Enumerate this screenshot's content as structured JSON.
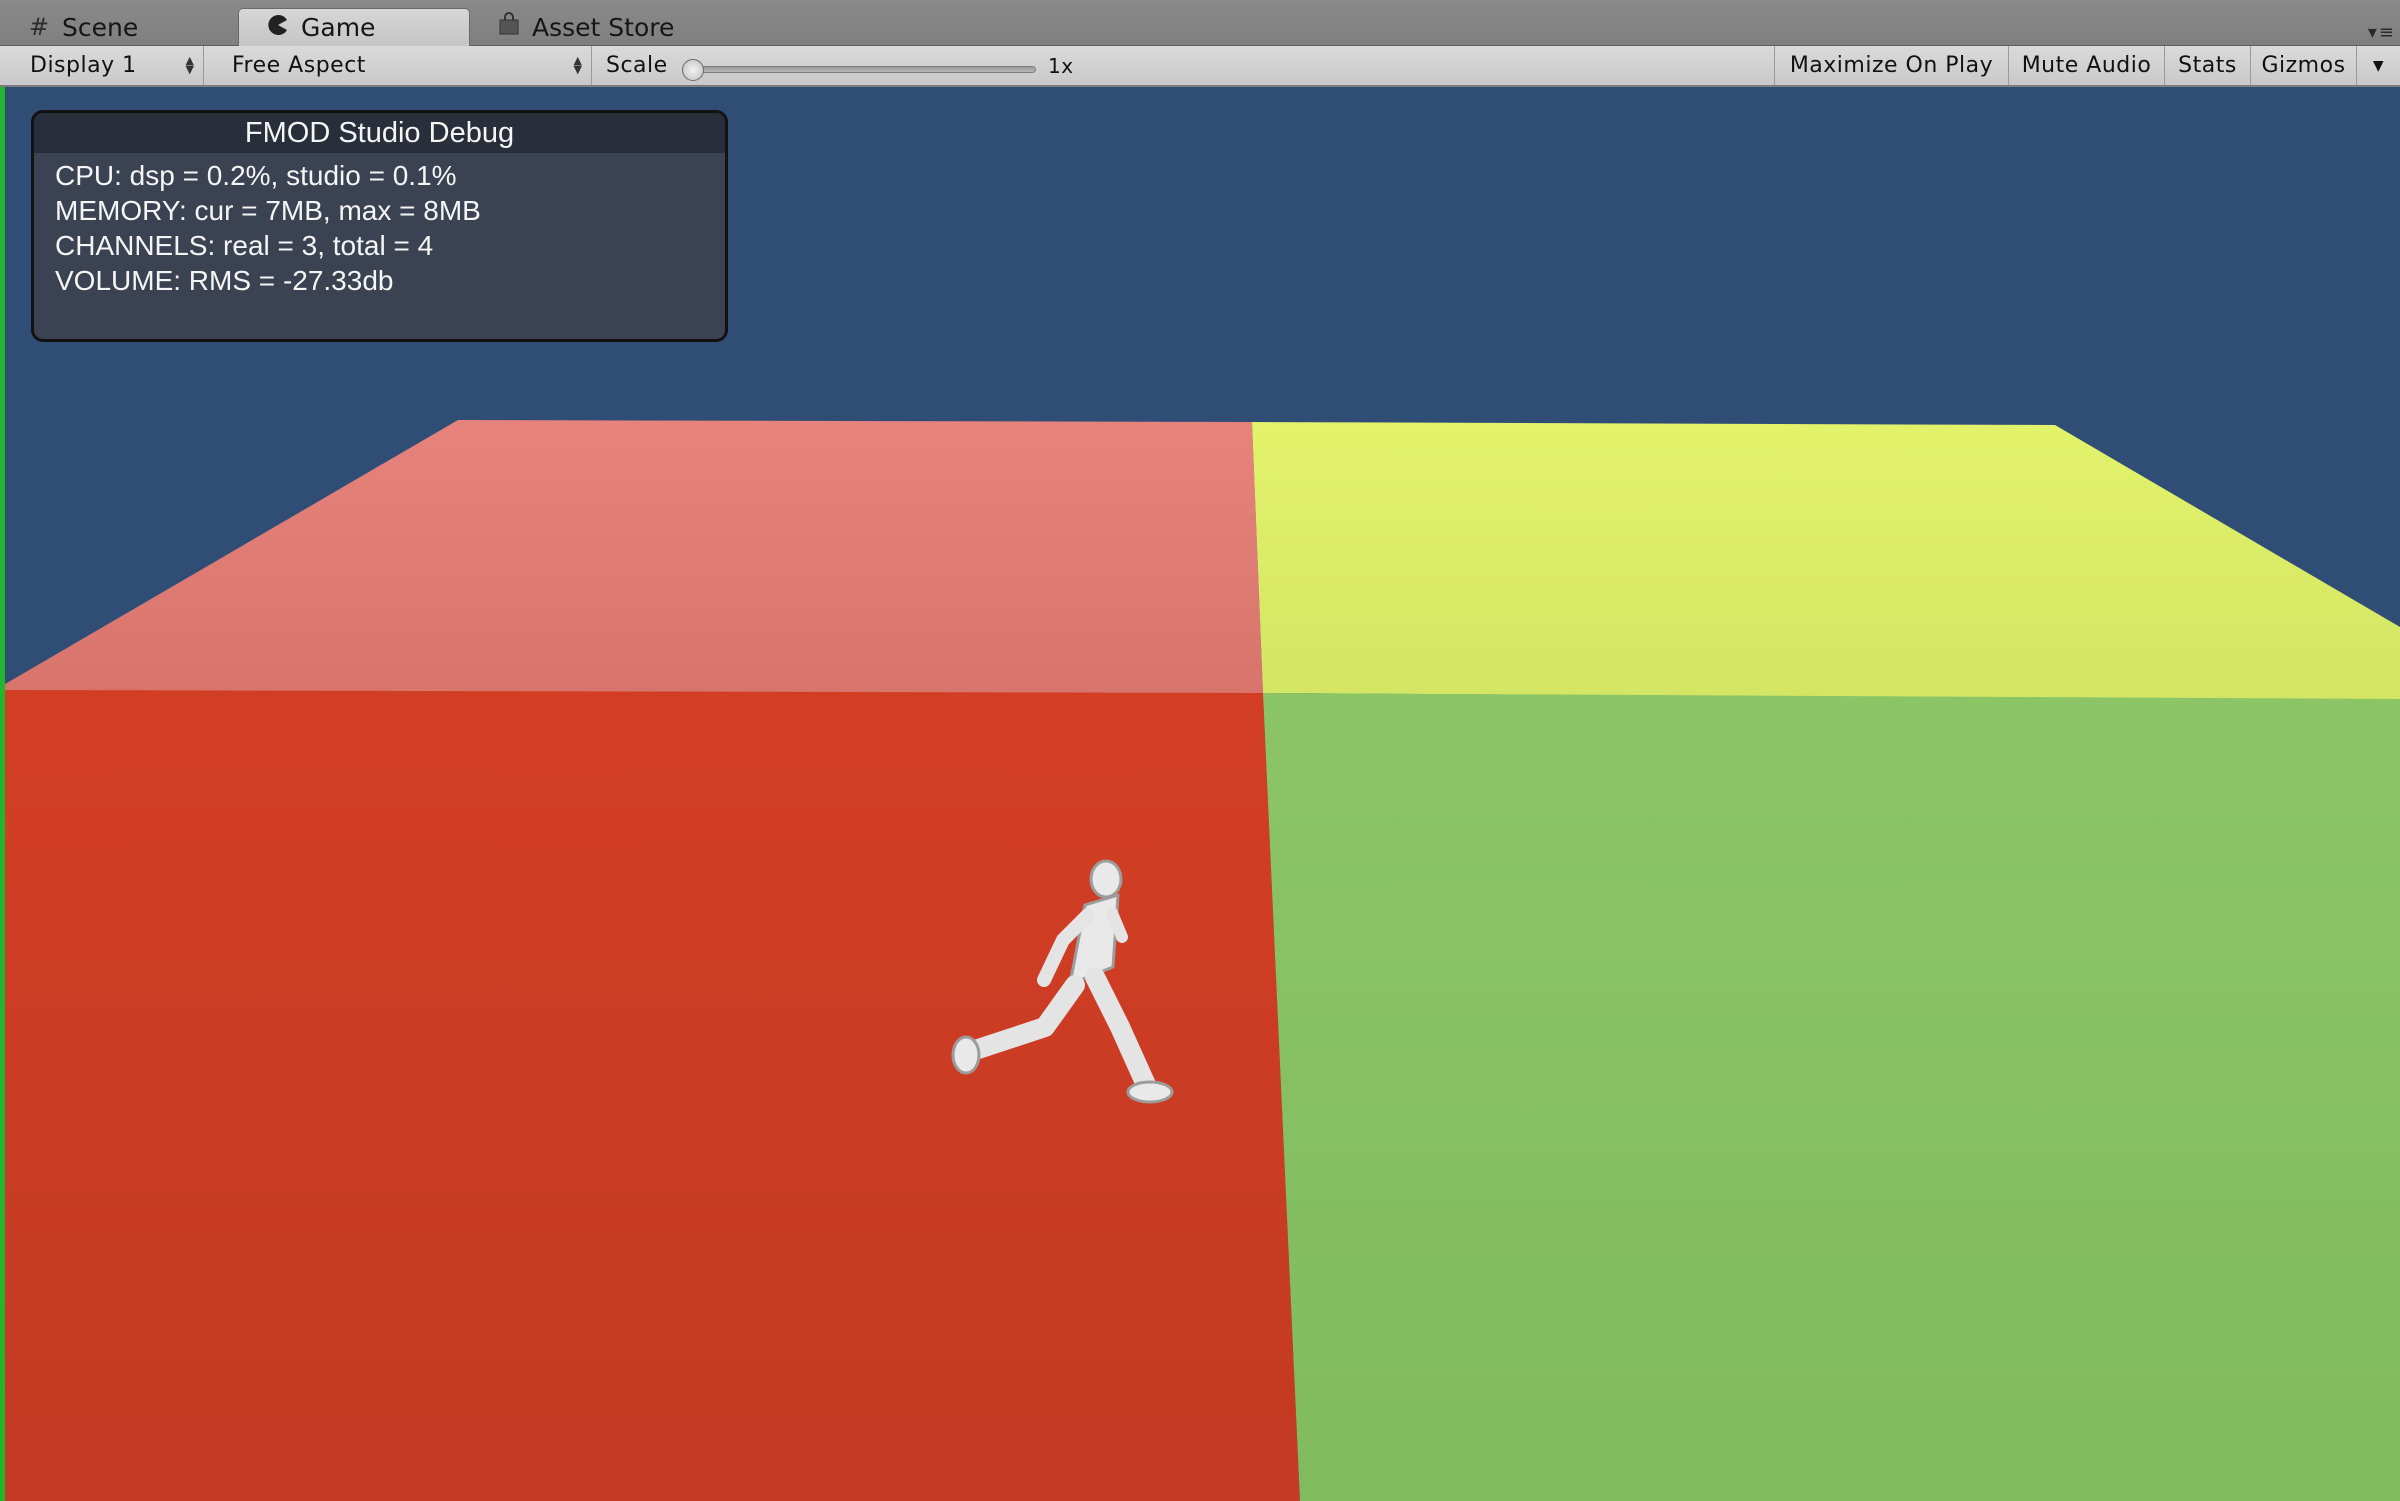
{
  "tabs": [
    {
      "label": "Scene",
      "icon": "grid-icon",
      "active": false
    },
    {
      "label": "Game",
      "icon": "pacman-icon",
      "active": true
    },
    {
      "label": "Asset Store",
      "icon": "bag-icon",
      "active": false
    }
  ],
  "toolbar": {
    "display_select": "Display 1",
    "aspect_select": "Free Aspect",
    "scale_label": "Scale",
    "scale_value": "1x",
    "scale_level": 0,
    "maximize_on_play": "Maximize On Play",
    "mute_audio": "Mute Audio",
    "stats": "Stats",
    "gizmos": "Gizmos"
  },
  "debug_panel": {
    "title": "FMOD Studio Debug",
    "lines": [
      "CPU: dsp = 0.2%, studio = 0.1%",
      "MEMORY: cur = 7MB, max = 8MB",
      "CHANNELS: real = 3, total = 4",
      "VOLUME: RMS = -27.33db"
    ]
  },
  "colors": {
    "sky": "#304d75",
    "floor_red": "#c93b26",
    "floor_red_far": "#de7b72",
    "floor_green": "#86bf62",
    "floor_yellow": "#dbec68",
    "play_indicator": "#22b52d"
  }
}
